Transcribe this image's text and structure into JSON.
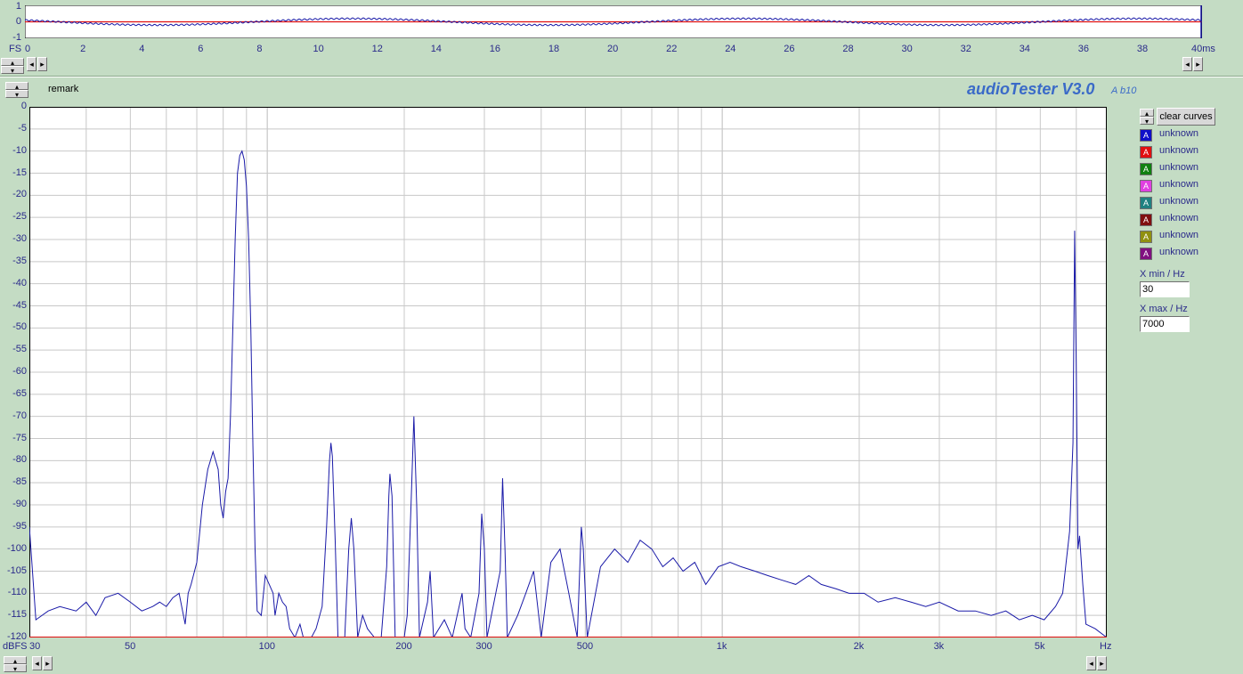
{
  "colors": {
    "blue": "#1a1aa8",
    "red": "#e01010",
    "grid": "#c8c8c8",
    "text": "#2a2a8a",
    "bg": "#c4dcc4"
  },
  "scope": {
    "y_labels": [
      "1",
      "0",
      "-1"
    ],
    "fs_label": "FS",
    "x_labels": [
      "0",
      "2",
      "4",
      "6",
      "8",
      "10",
      "12",
      "14",
      "16",
      "18",
      "20",
      "22",
      "24",
      "26",
      "28",
      "30",
      "32",
      "34",
      "36",
      "38"
    ],
    "x_last": "40ms"
  },
  "remark": {
    "label": "remark"
  },
  "brand": {
    "title": "audioTester V3.0",
    "version": "A b10"
  },
  "spectrum": {
    "y_labels": [
      "0",
      "-5",
      "-10",
      "-15",
      "-20",
      "-25",
      "-30",
      "-35",
      "-40",
      "-45",
      "-50",
      "-55",
      "-60",
      "-65",
      "-70",
      "-75",
      "-80",
      "-85",
      "-90",
      "-95",
      "-100",
      "-105",
      "-110",
      "-115",
      "-120"
    ],
    "y_unit": "dBFS",
    "x_ticks": [
      {
        "hz": 30,
        "label": "30"
      },
      {
        "hz": 50,
        "label": "50"
      },
      {
        "hz": 100,
        "label": "100"
      },
      {
        "hz": 200,
        "label": "200"
      },
      {
        "hz": 300,
        "label": "300"
      },
      {
        "hz": 500,
        "label": "500"
      },
      {
        "hz": 1000,
        "label": "1k"
      },
      {
        "hz": 2000,
        "label": "2k"
      },
      {
        "hz": 3000,
        "label": "3k"
      },
      {
        "hz": 5000,
        "label": "5k"
      }
    ],
    "x_unit": "Hz"
  },
  "legend": {
    "clear_label": "clear curves",
    "items": [
      {
        "label": "unknown",
        "color": "#1010c8"
      },
      {
        "label": "unknown",
        "color": "#e01010"
      },
      {
        "label": "unknown",
        "color": "#108010"
      },
      {
        "label": "unknown",
        "color": "#e040e0"
      },
      {
        "label": "unknown",
        "color": "#208080"
      },
      {
        "label": "unknown",
        "color": "#801010"
      },
      {
        "label": "unknown",
        "color": "#909010"
      },
      {
        "label": "unknown",
        "color": "#801080"
      }
    ],
    "xmin_label": "X min / Hz",
    "xmin_value": "30",
    "xmax_label": "X max / Hz",
    "xmax_value": "7000"
  },
  "chart_data": {
    "type": "line",
    "xscale": "log",
    "xlim": [
      30,
      7000
    ],
    "ylim": [
      -120,
      0
    ],
    "ylabel": "dBFS",
    "xlabel": "Hz",
    "grid": true,
    "series": [
      {
        "color": "#1a1aa8",
        "points": [
          [
            30,
            -95
          ],
          [
            31,
            -116
          ],
          [
            33,
            -114
          ],
          [
            35,
            -113
          ],
          [
            38,
            -114
          ],
          [
            40,
            -112
          ],
          [
            42,
            -115
          ],
          [
            44,
            -111
          ],
          [
            47,
            -110
          ],
          [
            50,
            -112
          ],
          [
            53,
            -114
          ],
          [
            56,
            -113
          ],
          [
            58,
            -112
          ],
          [
            60,
            -113
          ],
          [
            62,
            -111
          ],
          [
            64,
            -110
          ],
          [
            66,
            -117
          ],
          [
            67,
            -110
          ],
          [
            68,
            -108
          ],
          [
            70,
            -103
          ],
          [
            72,
            -90
          ],
          [
            74,
            -82
          ],
          [
            76,
            -78
          ],
          [
            78,
            -82
          ],
          [
            79,
            -90
          ],
          [
            80,
            -93
          ],
          [
            81,
            -87
          ],
          [
            82,
            -84
          ],
          [
            83,
            -70
          ],
          [
            84,
            -50
          ],
          [
            85,
            -30
          ],
          [
            86,
            -15
          ],
          [
            87,
            -11
          ],
          [
            88,
            -10
          ],
          [
            89,
            -12
          ],
          [
            90,
            -18
          ],
          [
            91,
            -30
          ],
          [
            92,
            -50
          ],
          [
            93,
            -77
          ],
          [
            94,
            -100
          ],
          [
            95,
            -114
          ],
          [
            97,
            -115
          ],
          [
            99,
            -106
          ],
          [
            101,
            -108
          ],
          [
            103,
            -110
          ],
          [
            104,
            -115
          ],
          [
            106,
            -110
          ],
          [
            108,
            -112
          ],
          [
            110,
            -113
          ],
          [
            112,
            -118
          ],
          [
            115,
            -120
          ],
          [
            118,
            -117
          ],
          [
            120,
            -120
          ],
          [
            125,
            -120
          ],
          [
            128,
            -118
          ],
          [
            132,
            -113
          ],
          [
            135,
            -95
          ],
          [
            137,
            -80
          ],
          [
            138,
            -76
          ],
          [
            139,
            -79
          ],
          [
            141,
            -98
          ],
          [
            143,
            -120
          ],
          [
            148,
            -120
          ],
          [
            151,
            -100
          ],
          [
            153,
            -93
          ],
          [
            155,
            -100
          ],
          [
            158,
            -120
          ],
          [
            162,
            -115
          ],
          [
            166,
            -118
          ],
          [
            172,
            -120
          ],
          [
            178,
            -120
          ],
          [
            183,
            -104
          ],
          [
            185,
            -88
          ],
          [
            186,
            -83
          ],
          [
            188,
            -88
          ],
          [
            191,
            -120
          ],
          [
            200,
            -120
          ],
          [
            203,
            -115
          ],
          [
            207,
            -90
          ],
          [
            210,
            -70
          ],
          [
            213,
            -90
          ],
          [
            216,
            -120
          ],
          [
            225,
            -112
          ],
          [
            228,
            -105
          ],
          [
            232,
            -120
          ],
          [
            245,
            -116
          ],
          [
            250,
            -118
          ],
          [
            255,
            -120
          ],
          [
            268,
            -110
          ],
          [
            272,
            -118
          ],
          [
            280,
            -120
          ],
          [
            292,
            -110
          ],
          [
            296,
            -92
          ],
          [
            300,
            -100
          ],
          [
            304,
            -120
          ],
          [
            325,
            -105
          ],
          [
            329,
            -84
          ],
          [
            333,
            -100
          ],
          [
            337,
            -120
          ],
          [
            355,
            -115
          ],
          [
            370,
            -110
          ],
          [
            385,
            -105
          ],
          [
            400,
            -120
          ],
          [
            420,
            -103
          ],
          [
            440,
            -100
          ],
          [
            460,
            -110
          ],
          [
            480,
            -120
          ],
          [
            490,
            -95
          ],
          [
            495,
            -100
          ],
          [
            505,
            -120
          ],
          [
            540,
            -104
          ],
          [
            580,
            -100
          ],
          [
            620,
            -103
          ],
          [
            660,
            -98
          ],
          [
            700,
            -100
          ],
          [
            740,
            -104
          ],
          [
            780,
            -102
          ],
          [
            820,
            -105
          ],
          [
            870,
            -103
          ],
          [
            920,
            -108
          ],
          [
            980,
            -104
          ],
          [
            1040,
            -103
          ],
          [
            1100,
            -104
          ],
          [
            1180,
            -105
          ],
          [
            1260,
            -106
          ],
          [
            1350,
            -107
          ],
          [
            1450,
            -108
          ],
          [
            1550,
            -106
          ],
          [
            1650,
            -108
          ],
          [
            1780,
            -109
          ],
          [
            1900,
            -110
          ],
          [
            2050,
            -110
          ],
          [
            2200,
            -112
          ],
          [
            2400,
            -111
          ],
          [
            2600,
            -112
          ],
          [
            2800,
            -113
          ],
          [
            3000,
            -112
          ],
          [
            3300,
            -114
          ],
          [
            3600,
            -114
          ],
          [
            3900,
            -115
          ],
          [
            4200,
            -114
          ],
          [
            4500,
            -116
          ],
          [
            4800,
            -115
          ],
          [
            5100,
            -116
          ],
          [
            5400,
            -113
          ],
          [
            5600,
            -110
          ],
          [
            5800,
            -96
          ],
          [
            5900,
            -76
          ],
          [
            5950,
            -28
          ],
          [
            6000,
            -60
          ],
          [
            6050,
            -100
          ],
          [
            6100,
            -97
          ],
          [
            6200,
            -108
          ],
          [
            6300,
            -117
          ],
          [
            6600,
            -118
          ],
          [
            7000,
            -120
          ]
        ]
      },
      {
        "color": "#e01010",
        "points": [
          [
            30,
            -120
          ],
          [
            7000,
            -120
          ]
        ]
      }
    ]
  }
}
